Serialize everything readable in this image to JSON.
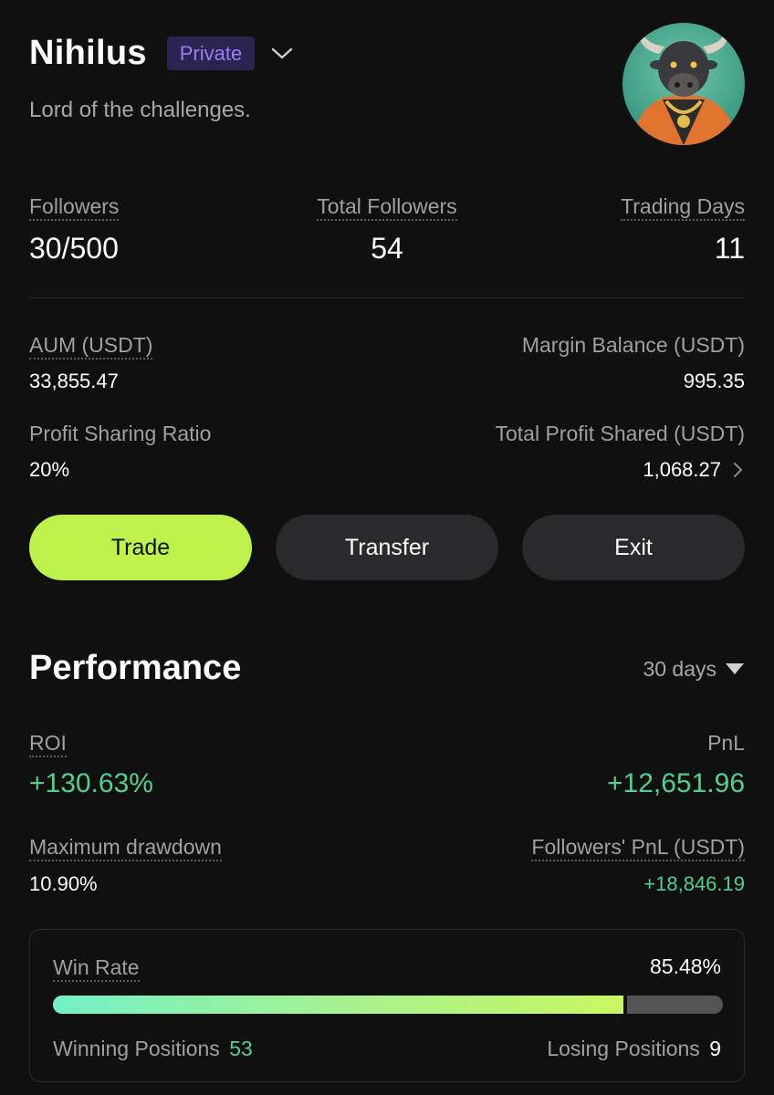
{
  "profile": {
    "name": "Nihilus",
    "badge": "Private",
    "bio": "Lord of the challenges.",
    "avatar_icon": "bull-avatar"
  },
  "stats": {
    "followers_label": "Followers",
    "followers_value": "30/500",
    "total_followers_label": "Total Followers",
    "total_followers_value": "54",
    "trading_days_label": "Trading Days",
    "trading_days_value": "11"
  },
  "balances": {
    "aum_label": "AUM (USDT)",
    "aum_value": "33,855.47",
    "margin_label": "Margin Balance (USDT)",
    "margin_value": "995.35",
    "profit_ratio_label": "Profit Sharing Ratio",
    "profit_ratio_value": "20%",
    "profit_shared_label": "Total Profit Shared (USDT)",
    "profit_shared_value": "1,068.27"
  },
  "actions": {
    "trade": "Trade",
    "transfer": "Transfer",
    "exit": "Exit"
  },
  "performance": {
    "title": "Performance",
    "period": "30 days",
    "roi_label": "ROI",
    "roi_value": "+130.63%",
    "pnl_label": "PnL",
    "pnl_value": "+12,651.96",
    "drawdown_label": "Maximum drawdown",
    "drawdown_value": "10.90%",
    "followers_pnl_label": "Followers' PnL (USDT)",
    "followers_pnl_value": "+18,846.19"
  },
  "win_rate": {
    "label": "Win Rate",
    "value": "85.48%",
    "fraction": 0.8548,
    "winning_label": "Winning Positions",
    "winning_value": "53",
    "losing_label": "Losing Positions",
    "losing_value": "9"
  },
  "colors": {
    "accent": "#bdf24c",
    "positive": "#4fd08f",
    "badge_text": "#9b7cf6",
    "background": "#101010"
  }
}
